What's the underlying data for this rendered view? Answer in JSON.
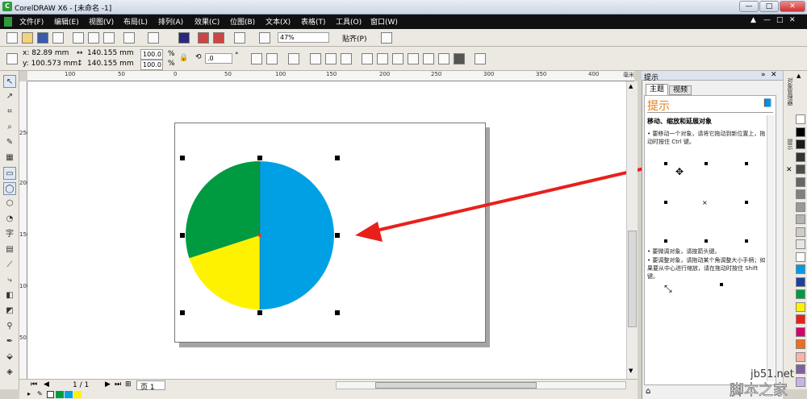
{
  "window": {
    "title": "CorelDRAW X6 - [未命名 -1]",
    "app_icon": "coreldraw-icon",
    "controls": [
      "—",
      "□",
      "✕"
    ]
  },
  "menu": [
    "文件(F)",
    "编辑(E)",
    "视图(V)",
    "布局(L)",
    "排列(A)",
    "效果(C)",
    "位图(B)",
    "文本(X)",
    "表格(T)",
    "工具(O)",
    "窗口(W)"
  ],
  "menu_right": [
    "▲",
    "—",
    "□",
    "✕"
  ],
  "toolbar": {
    "zoom": "47%",
    "snap": "贴齐(P)"
  },
  "props": {
    "x": "x:  82.89 mm",
    "y": "y:  100.573 mm",
    "w": "140.155 mm",
    "h": "140.155 mm",
    "sx": "100.0",
    "sy": "100.0",
    "pct": "%",
    "angle": ".0",
    "deg": "°"
  },
  "ruler_h": [
    "100",
    "50",
    "0",
    "50",
    "100",
    "150",
    "200",
    "250",
    "300",
    "350",
    "400",
    "毫米"
  ],
  "ruler_v": [
    "250",
    "200",
    "150",
    "100",
    "50"
  ],
  "pie": {
    "colors": {
      "blue": "#00a0e4",
      "green": "#009a40",
      "yellow": "#fff200"
    },
    "fractions": {
      "blue": 0.5,
      "green": 0.3,
      "yellow": 0.2
    }
  },
  "arrow_color": "#e8201c",
  "page_nav": {
    "page": "1 / 1",
    "tab": "页 1"
  },
  "docker": {
    "header": "提示",
    "tabs": [
      "主题",
      "视频"
    ],
    "heading": "提示",
    "subheading": "移动、缩放和延展对象",
    "bullet1": "要移动一个对象，请将它拖动到新位置上，拖动时按住 Ctrl 键。",
    "bullet2": "要微调对象，请按箭头键。",
    "bullet3": "要调整对象，请拖动某个角调整大小手柄；如果要从中心进行缩放，请在拖动时按住 Shift 键。"
  },
  "vtabs": [
    "对象管理器",
    "提示"
  ],
  "palette": [
    "#ffffff",
    "#000000",
    "#1b1b1b",
    "#333333",
    "#4d4d4d",
    "#666666",
    "#808080",
    "#999999",
    "#b3b3b3",
    "#cccccc",
    "#e6e6e6",
    "#ffffff",
    "#0099e6",
    "#1f3f9f",
    "#009a40",
    "#fff200",
    "#e8201c",
    "#d6006b",
    "#ee6e1c",
    "#f9b3a9",
    "#7f5f9f",
    "#c7b3e6"
  ],
  "watermark": {
    "line1": "jb51.net",
    "line2": "脚本之家"
  }
}
